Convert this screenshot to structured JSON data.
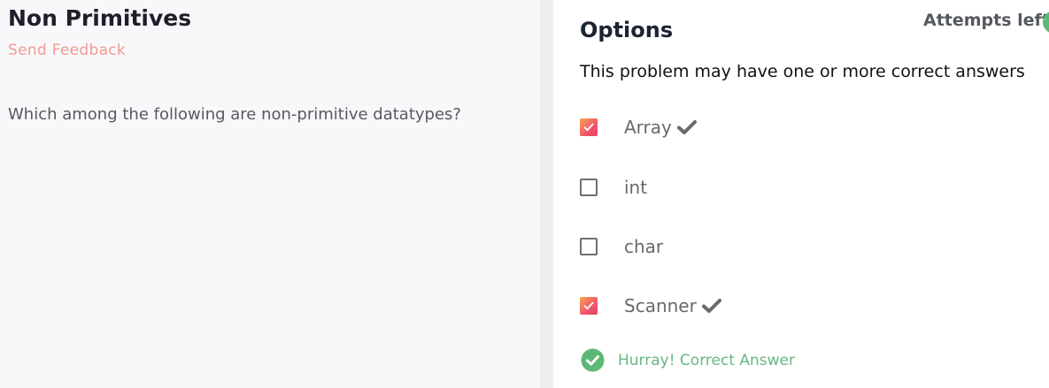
{
  "problem": {
    "title": "Non Primitives",
    "feedback_label": "Send Feedback",
    "question": "Which among the following are non-primitive datatypes?"
  },
  "options_panel": {
    "title": "Options",
    "attempts_label": "Attempts left:",
    "hint": "This problem may have one or more correct answers",
    "options": [
      {
        "label": "Array",
        "checked": true,
        "marked_correct": true
      },
      {
        "label": "int",
        "checked": false,
        "marked_correct": false
      },
      {
        "label": "char",
        "checked": false,
        "marked_correct": false
      },
      {
        "label": "Scanner",
        "checked": true,
        "marked_correct": true
      }
    ],
    "result": "Hurray! Correct Answer"
  },
  "colors": {
    "accent_feedback": "#f29a92",
    "checkbox_gradient_start": "#f6a64e",
    "checkbox_gradient_end": "#e8435e",
    "success": "#5db875"
  },
  "icons": {
    "checkbox_checked": "check-icon",
    "correct_mark": "checkmark-icon",
    "result": "check-circle-icon"
  }
}
